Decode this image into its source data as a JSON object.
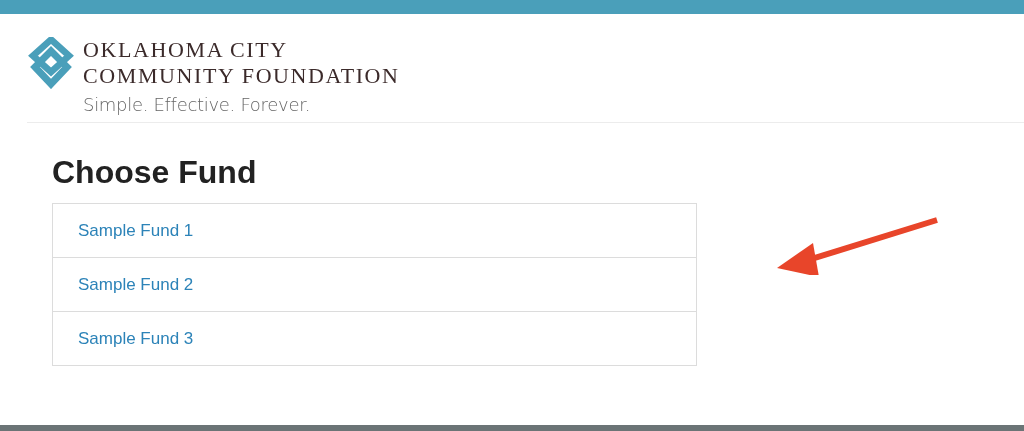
{
  "header": {
    "org_name_line_1": "OKLAHOMA CITY",
    "org_name_line_2": "COMMUNITY FOUNDATION",
    "tagline": "Simple. Effective. Forever."
  },
  "page": {
    "title": "Choose Fund"
  },
  "funds": [
    {
      "label": "Sample Fund 1"
    },
    {
      "label": "Sample Fund 2"
    },
    {
      "label": "Sample Fund 3"
    }
  ]
}
